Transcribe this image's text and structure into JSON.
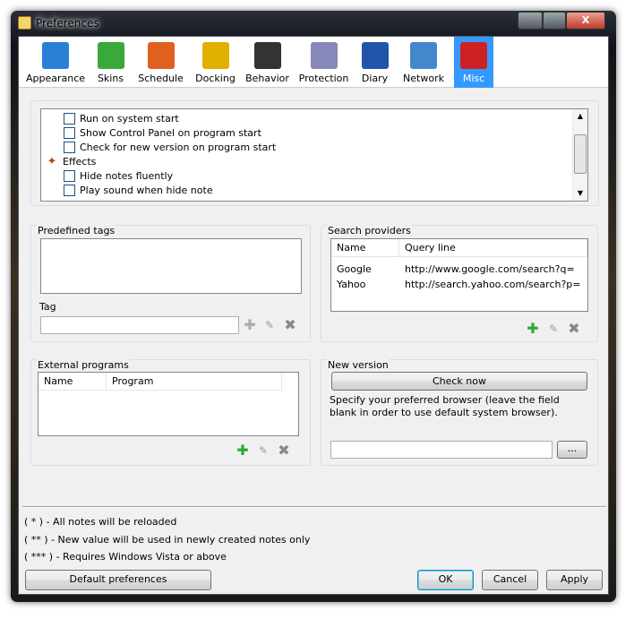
{
  "window": {
    "title": "Preferences",
    "minimize": "—",
    "maximize": "▫",
    "close": "X"
  },
  "toolbar": [
    {
      "label": "Appearance",
      "icon": "appearance-icon",
      "color": "#2a7fd6"
    },
    {
      "label": "Skins",
      "icon": "puzzle-icon",
      "color": "#3aa83a"
    },
    {
      "label": "Schedule",
      "icon": "calendar-icon",
      "color": "#e06020"
    },
    {
      "label": "Docking",
      "icon": "docking-icon",
      "color": "#e0b000"
    },
    {
      "label": "Behavior",
      "icon": "computer-icon",
      "color": "#333333"
    },
    {
      "label": "Protection",
      "icon": "shield-icon",
      "color": "#8888bb"
    },
    {
      "label": "Diary",
      "icon": "book-icon",
      "color": "#2255aa"
    },
    {
      "label": "Network",
      "icon": "network-icon",
      "color": "#4488cc"
    },
    {
      "label": "Misc",
      "icon": "checklist-icon",
      "color": "#cc2222",
      "selected": true
    }
  ],
  "options": {
    "items": [
      {
        "label": "Run on system start",
        "checked": false
      },
      {
        "label": "Show Control Panel on program start",
        "checked": false
      },
      {
        "label": "Check for new version on program start",
        "checked": false
      },
      {
        "label": "Effects",
        "group": true
      },
      {
        "label": "Hide notes fluently",
        "checked": false
      },
      {
        "label": "Play sound when hide note",
        "checked": false
      }
    ]
  },
  "predefined_tags": {
    "title": "Predefined tags",
    "tag_label": "Tag",
    "tag_value": ""
  },
  "search_providers": {
    "title": "Search providers",
    "columns": [
      "Name",
      "Query line"
    ],
    "rows": [
      [
        "Google",
        "http://www.google.com/search?q="
      ],
      [
        "Yahoo",
        "http://search.yahoo.com/search?p="
      ]
    ]
  },
  "external_programs": {
    "title": "External programs",
    "columns": [
      "Name",
      "Program"
    ],
    "rows": []
  },
  "new_version": {
    "title": "New version",
    "check_now": "Check now",
    "description": "Specify your preferred browser (leave the field blank in order to use default system browser).",
    "browser_value": "",
    "browse": "..."
  },
  "notes": [
    "( * ) - All notes will be reloaded",
    "( ** ) - New value will be used in newly created notes only",
    "( *** ) - Requires Windows Vista or above"
  ],
  "buttons": {
    "default": "Default preferences",
    "ok": "OK",
    "cancel": "Cancel",
    "apply": "Apply"
  }
}
